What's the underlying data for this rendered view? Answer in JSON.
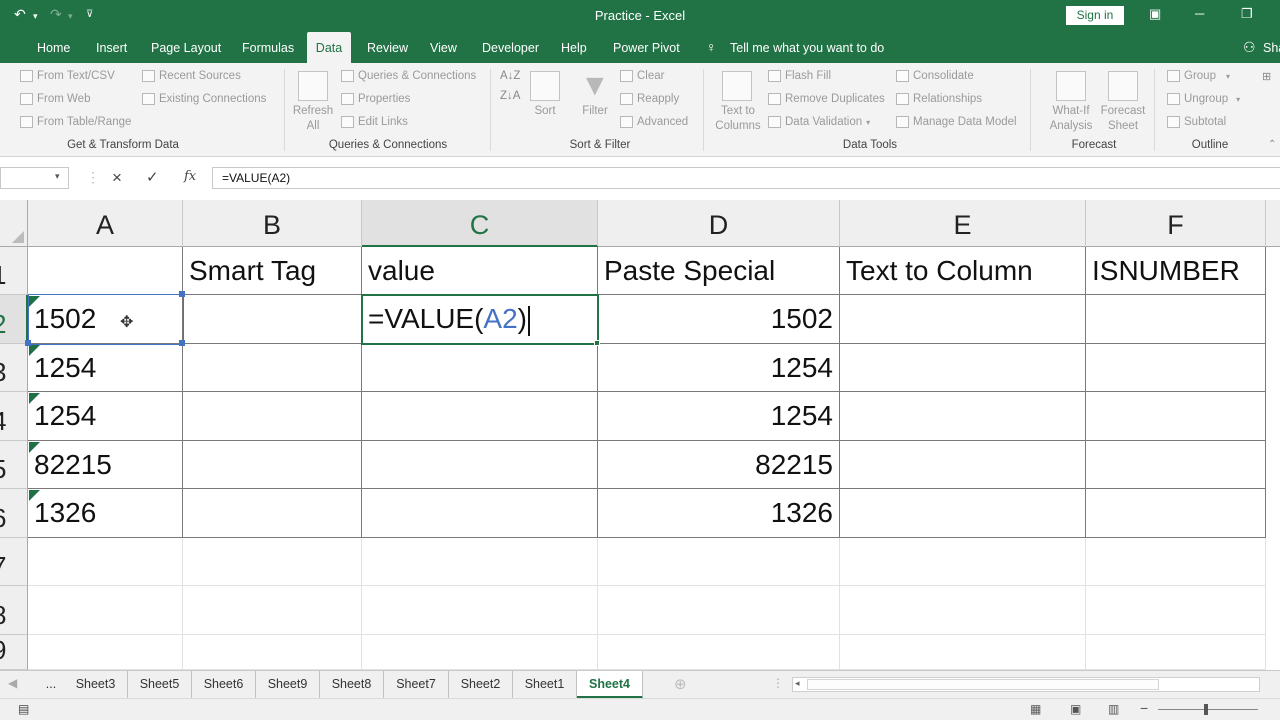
{
  "window": {
    "title": "Practice  -  Excel",
    "signin_label": "Sign in",
    "undo_icon": "undo-icon",
    "redo_icon": "redo-icon",
    "customize_icon": "customize-icon"
  },
  "tabs": [
    {
      "label": "Home"
    },
    {
      "label": "Insert"
    },
    {
      "label": "Page Layout"
    },
    {
      "label": "Formulas"
    },
    {
      "label": "Data",
      "active": true
    },
    {
      "label": "Review"
    },
    {
      "label": "View"
    },
    {
      "label": "Developer"
    },
    {
      "label": "Help"
    },
    {
      "label": "Power Pivot"
    }
  ],
  "tell_me": "Tell me what you want to do",
  "share": "Sha",
  "ribbon": {
    "get_transform": {
      "from_text": "From Text/CSV",
      "from_web": "From Web",
      "from_table": "From Table/Range",
      "recent_sources": "Recent Sources",
      "existing_connections": "Existing Connections",
      "group_label": "Get & Transform Data"
    },
    "queries": {
      "refresh_all_1": "Refresh",
      "refresh_all_2": "All",
      "queries_connections": "Queries & Connections",
      "properties": "Properties",
      "edit_links": "Edit Links",
      "group_label": "Queries & Connections"
    },
    "sort_filter": {
      "sort": "Sort",
      "filter": "Filter",
      "clear": "Clear",
      "reapply": "Reapply",
      "advanced": "Advanced",
      "group_label": "Sort & Filter"
    },
    "data_tools": {
      "text_to_columns_1": "Text to",
      "text_to_columns_2": "Columns",
      "flash_fill": "Flash Fill",
      "remove_duplicates": "Remove Duplicates",
      "data_validation": "Data Validation",
      "consolidate": "Consolidate",
      "relationships": "Relationships",
      "manage_data_model": "Manage Data Model",
      "group_label": "Data Tools"
    },
    "forecast": {
      "what_if_1": "What-If",
      "what_if_2": "Analysis",
      "forecast_sheet_1": "Forecast",
      "forecast_sheet_2": "Sheet",
      "group_label": "Forecast"
    },
    "outline": {
      "group": "Group",
      "ungroup": "Ungroup",
      "subtotal": "Subtotal",
      "group_label": "Outline"
    }
  },
  "formula_bar": {
    "cancel_icon": "×",
    "enter_icon": "✓",
    "fx_label": "fx",
    "formula": "=VALUE(A2)"
  },
  "columns": [
    "A",
    "B",
    "C",
    "D",
    "E",
    "F"
  ],
  "rows": [
    "1",
    "2",
    "3",
    "4",
    "5",
    "6",
    "7",
    "8",
    "9"
  ],
  "headers": {
    "B": "Smart Tag",
    "C": "value",
    "D": "Paste Special",
    "E": "Text to Column",
    "F": "ISNUMBER"
  },
  "colA": [
    "1502",
    "1254",
    "1254",
    "82215",
    "1326"
  ],
  "colD": [
    "1502",
    "1254",
    "1254",
    "82215",
    "1326"
  ],
  "active_cell": {
    "formula_prefix": "=VALUE(",
    "formula_ref": "A2",
    "formula_suffix": ")",
    "ref_color": "#4472c4"
  },
  "sheets": [
    "...",
    "Sheet3",
    "Sheet5",
    "Sheet6",
    "Sheet9",
    "Sheet8",
    "Sheet7",
    "Sheet2",
    "Sheet1",
    "Sheet4"
  ],
  "active_sheet": "Sheet4",
  "colors": {
    "brand": "#217346",
    "error_triangle": "#1e7145"
  }
}
